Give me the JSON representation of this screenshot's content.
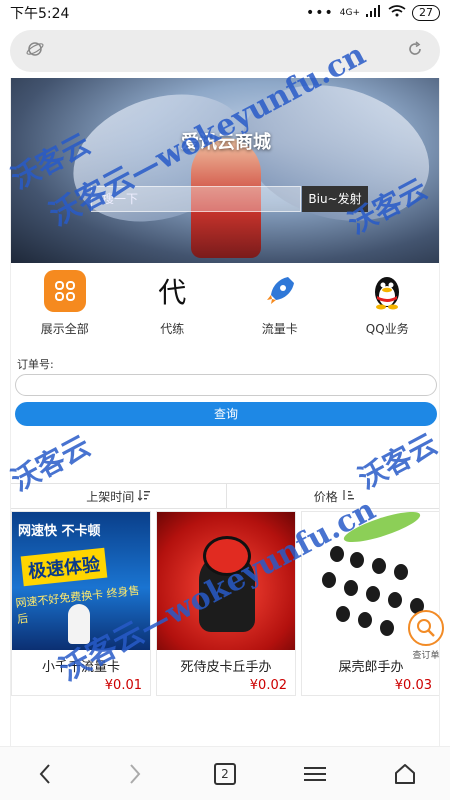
{
  "status_bar": {
    "time": "下午5:24",
    "signal_text": "4G+",
    "battery": "27"
  },
  "url_bar": {
    "left_icon": "planet-icon",
    "right_icon": "refresh-icon"
  },
  "banner": {
    "title": "爱讯云商城",
    "search_placeholder": "搜一下",
    "button_label": "Biu~发射"
  },
  "categories": [
    {
      "label": "展示全部",
      "icon": "grid-icon"
    },
    {
      "label": "代练",
      "icon": "char-icon",
      "glyph": "代"
    },
    {
      "label": "流量卡",
      "icon": "rocket-icon"
    },
    {
      "label": "QQ业务",
      "icon": "qq-penguin-icon"
    }
  ],
  "order": {
    "label": "订单号:",
    "input_value": "",
    "query_button": "查询"
  },
  "sort": {
    "by_time": "上架时间",
    "by_price": "价格"
  },
  "products": [
    {
      "name": "小千千流量卡",
      "price": "¥0.01",
      "image": {
        "line1": "网速快 不卡顿",
        "line2": "极速体验",
        "line3": "网速不好免费换卡 终身售后"
      }
    },
    {
      "name": "死侍皮卡丘手办",
      "price": "¥0.02",
      "image": {}
    },
    {
      "name": "屎壳郎手办",
      "price": "¥0.03",
      "image": {}
    }
  ],
  "floating_order": {
    "label": "查订单"
  },
  "watermark": {
    "text_main": "沃客云—wokeyunfu.cn",
    "text_side": "沃客云"
  },
  "bottom_nav": {
    "back": "‹",
    "forward": "›",
    "tabs_count": "2",
    "menu": "≡",
    "home": "⌂"
  },
  "colors": {
    "accent": "#1e88e5",
    "price": "#cc0000",
    "orange": "#f58a1f",
    "watermark": "#2858c8"
  }
}
